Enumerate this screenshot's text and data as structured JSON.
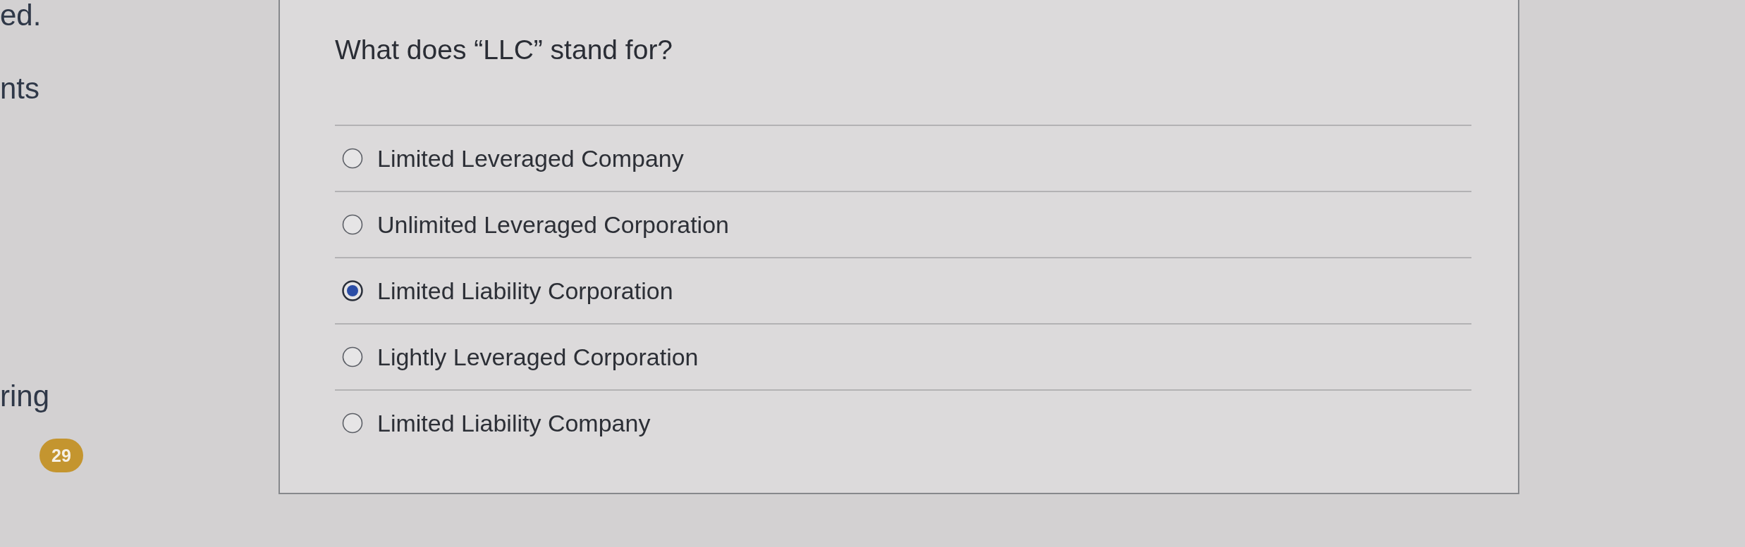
{
  "sidebar": {
    "items": [
      {
        "label": "ed."
      },
      {
        "label": "nts"
      },
      {
        "label": "ring"
      }
    ],
    "badge": "29"
  },
  "question": {
    "text": "What does “LLC” stand for?",
    "options": [
      {
        "label": "Limited Leveraged Company",
        "selected": false
      },
      {
        "label": "Unlimited Leveraged Corporation",
        "selected": false
      },
      {
        "label": "Limited Liability Corporation",
        "selected": true
      },
      {
        "label": "Lightly Leveraged Corporation",
        "selected": false
      },
      {
        "label": "Limited Liability Company",
        "selected": false
      }
    ]
  }
}
